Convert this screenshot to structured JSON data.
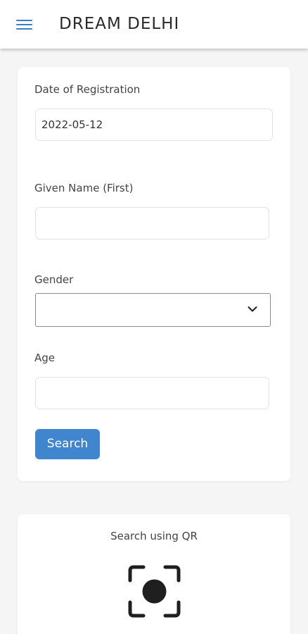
{
  "header": {
    "title": "DREAM DELHI",
    "menu_icon": "hamburger-menu-icon",
    "accent_color": "#3a7fc4"
  },
  "form": {
    "date_label": "Date of Registration",
    "date_value": "2022-05-12",
    "given_name_label": "Given Name (First)",
    "given_name_value": "",
    "gender_label": "Gender",
    "gender_value": "",
    "gender_icon": "chevron-down-icon",
    "age_label": "Age",
    "age_value": "",
    "search_label": "Search",
    "button_color": "#3f86cf"
  },
  "qr": {
    "title": "Search using QR",
    "icon": "qr-scan-icon"
  }
}
